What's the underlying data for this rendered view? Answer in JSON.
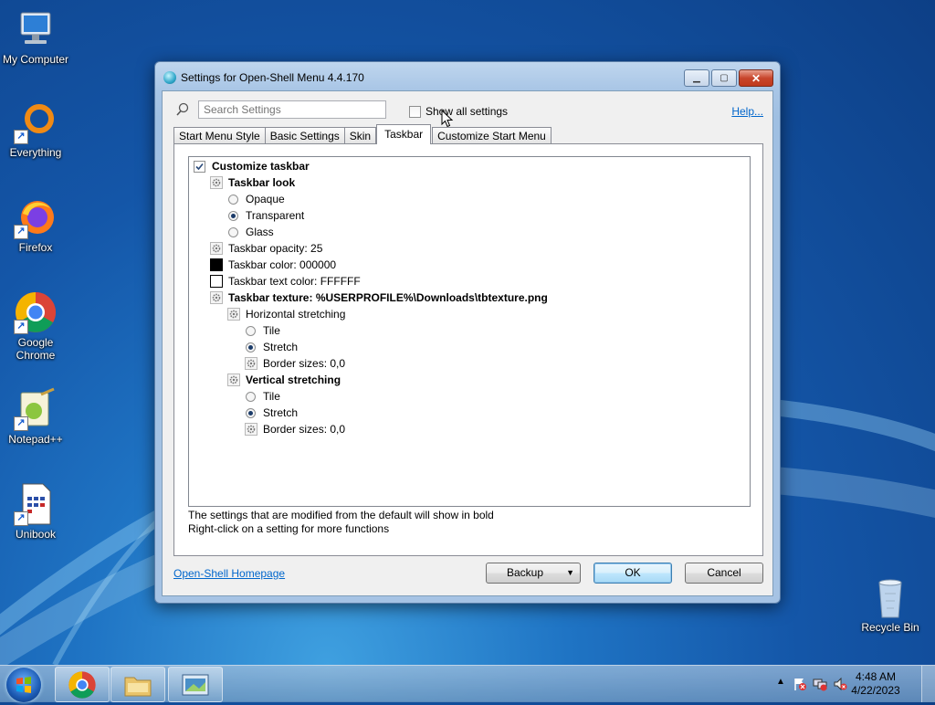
{
  "desktop": {
    "icons": [
      {
        "label": "My Computer"
      },
      {
        "label": "Everything"
      },
      {
        "label": "Firefox"
      },
      {
        "label": "Google Chrome"
      },
      {
        "label": "Notepad++"
      },
      {
        "label": "Unibook"
      },
      {
        "label": "Recycle Bin"
      }
    ]
  },
  "dialog": {
    "title": "Settings for Open-Shell Menu 4.4.170",
    "search_placeholder": "Search Settings",
    "show_all_label": "Show all settings",
    "show_all_checked": false,
    "help_link": "Help...",
    "tabs": [
      {
        "label": "Start Menu Style",
        "active": false
      },
      {
        "label": "Basic Settings",
        "active": false
      },
      {
        "label": "Skin",
        "active": false
      },
      {
        "label": "Taskbar",
        "active": true
      },
      {
        "label": "Customize Start Menu",
        "active": false
      }
    ],
    "tree": {
      "customize_taskbar": {
        "label": "Customize taskbar",
        "checked": true
      },
      "taskbar_look": {
        "label": "Taskbar look",
        "options": [
          {
            "label": "Opaque",
            "selected": false
          },
          {
            "label": "Transparent",
            "selected": true
          },
          {
            "label": "Glass",
            "selected": false
          }
        ]
      },
      "opacity": "Taskbar opacity: 25",
      "color": {
        "label": "Taskbar color: 000000",
        "swatch": "#000000"
      },
      "text_color": {
        "label": "Taskbar text color: FFFFFF",
        "swatch": "#FFFFFF"
      },
      "texture": "Taskbar texture: %USERPROFILE%\\Downloads\\tbtexture.png",
      "horizontal": {
        "label": "Horizontal stretching",
        "options": [
          {
            "label": "Tile",
            "selected": false
          },
          {
            "label": "Stretch",
            "selected": true
          }
        ],
        "border": "Border sizes: 0,0"
      },
      "vertical": {
        "label": "Vertical stretching",
        "options": [
          {
            "label": "Tile",
            "selected": false
          },
          {
            "label": "Stretch",
            "selected": true
          }
        ],
        "border": "Border sizes: 0,0"
      }
    },
    "hint_line1": "The settings that are modified from the default will show in bold",
    "hint_line2": "Right-click on a setting for more functions",
    "homepage_link": "Open-Shell Homepage",
    "buttons": {
      "backup": "Backup",
      "ok": "OK",
      "cancel": "Cancel"
    }
  },
  "taskbar": {
    "time": "4:48 AM",
    "date": "4/22/2023"
  },
  "colors": {
    "accent_link": "#0066cc",
    "close_button": "#c8462c",
    "desktop": "#1456a8"
  }
}
